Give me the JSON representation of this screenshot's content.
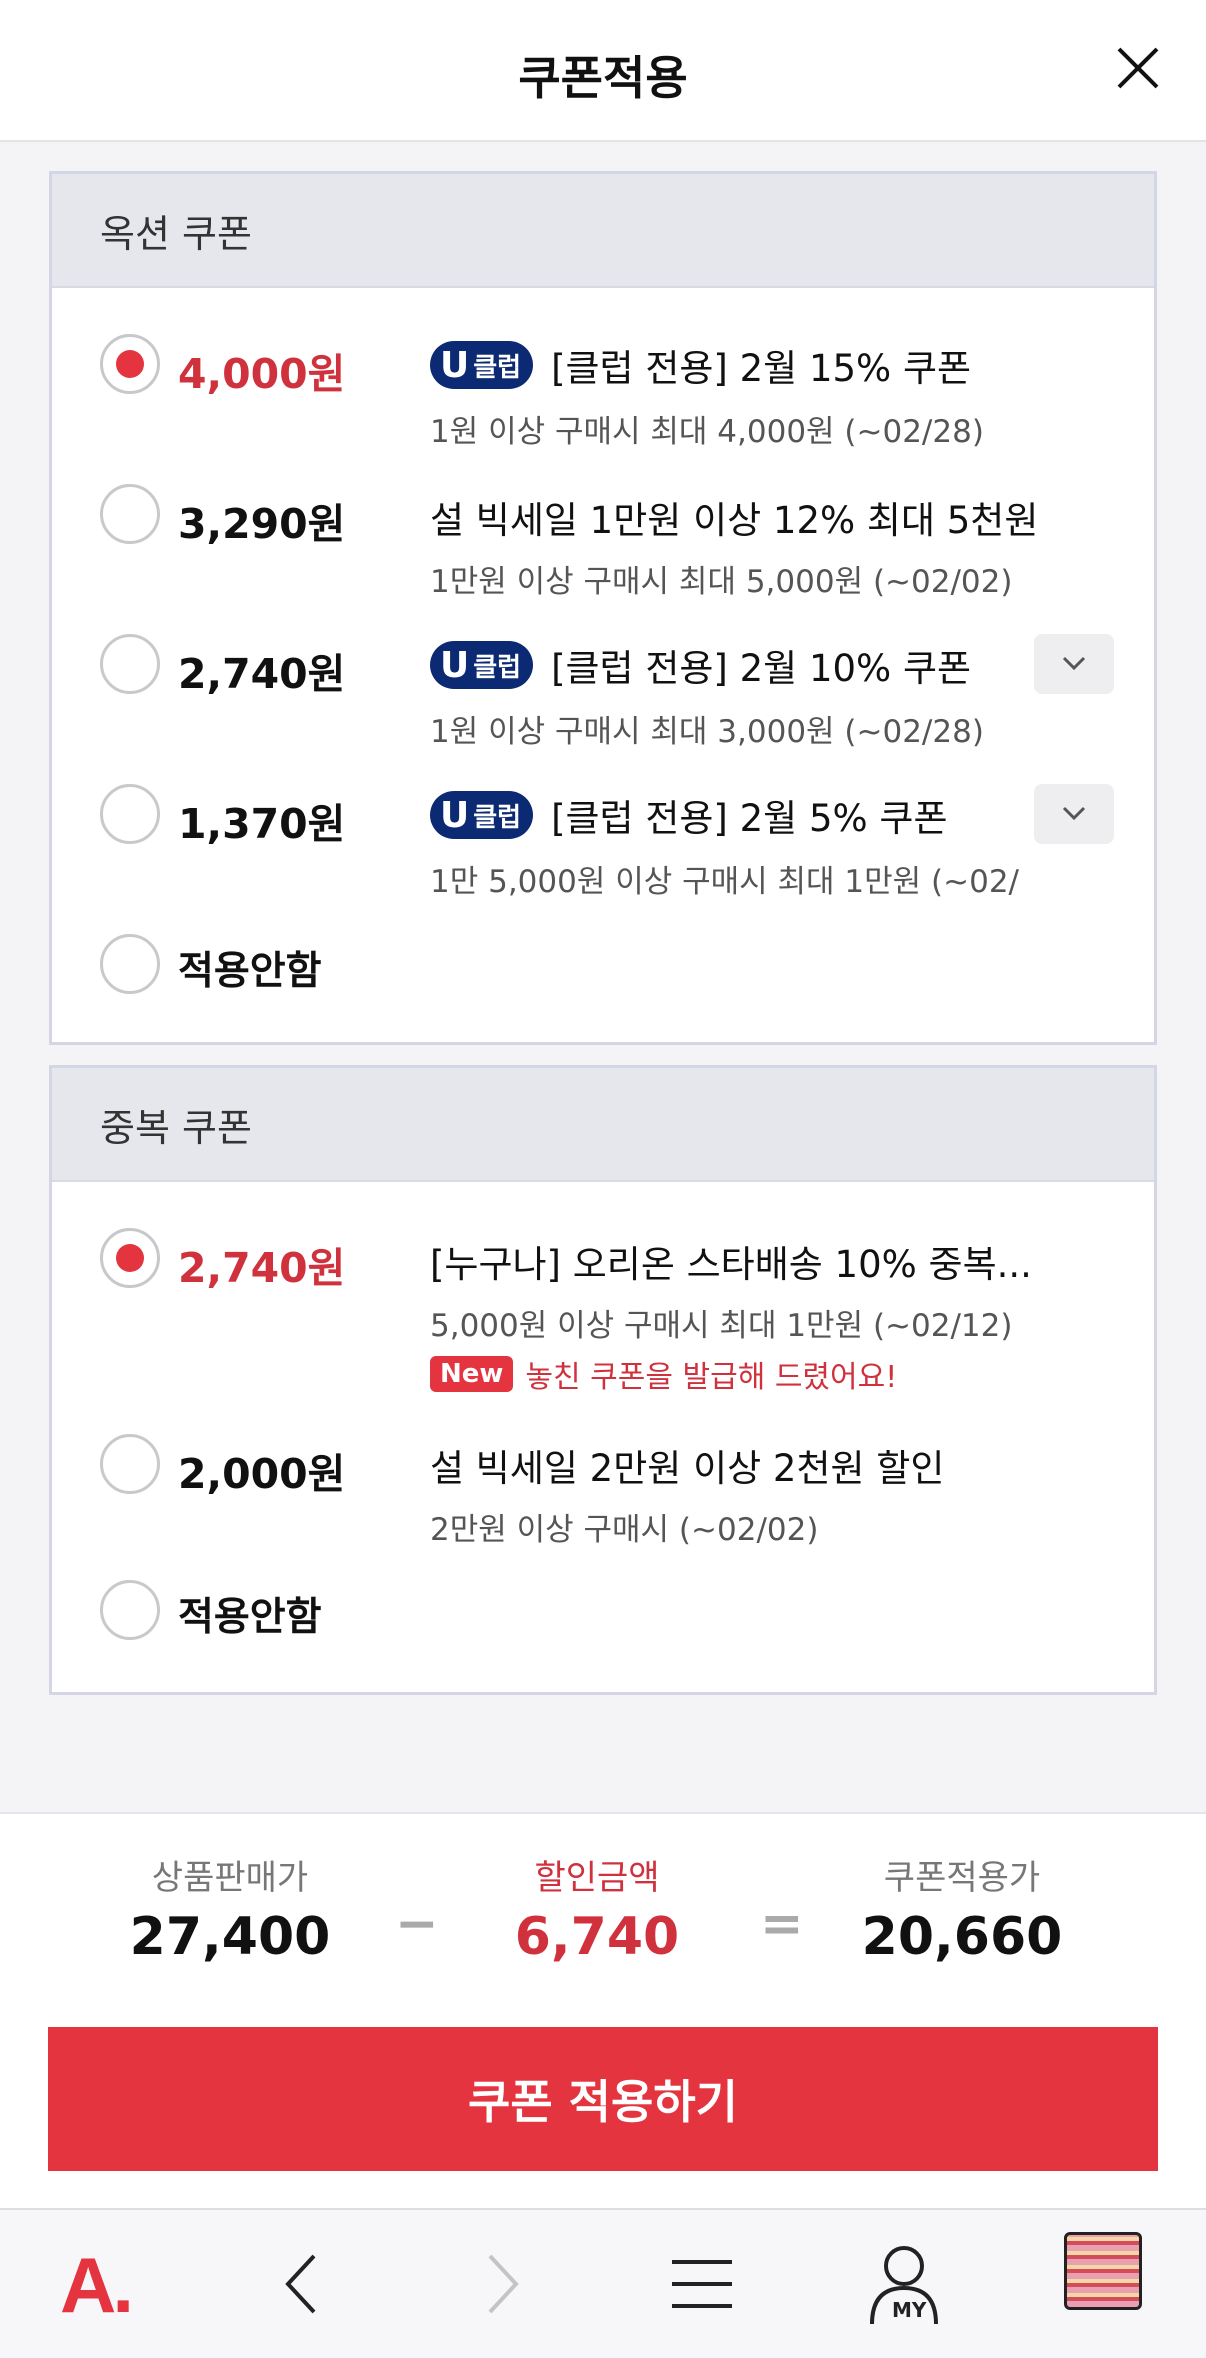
{
  "header": {
    "title": "쿠폰적용"
  },
  "option_section": {
    "title": "옥션 쿠폰",
    "items": [
      {
        "amount": "4,000원",
        "badge": "클럽",
        "title": "[클럽 전용] 2월 15% 쿠폰",
        "sub": "1원 이상 구매시 최대 4,000원 (~02/28)",
        "selected": true
      },
      {
        "amount": "3,290원",
        "title": "설 빅세일 1만원 이상 12% 최대 5천원",
        "sub": "1만원 이상 구매시 최대 5,000원 (~02/02)",
        "selected": false
      },
      {
        "amount": "2,740원",
        "badge": "클럽",
        "title": "[클럽 전용] 2월 10% 쿠폰",
        "sub": "1원 이상 구매시 최대 3,000원 (~02/28)",
        "selected": false
      },
      {
        "amount": "1,370원",
        "badge": "클럽",
        "title": "[클럽 전용] 2월 5% 쿠폰",
        "sub": "1만 5,000원 이상 구매시 최대 1만원 (~02/",
        "selected": false
      }
    ],
    "none_label": "적용안함"
  },
  "dup_section": {
    "title": "중복 쿠폰",
    "items": [
      {
        "amount": "2,740원",
        "title": "[누구나] 오리온 스타배송 10% 중복...",
        "sub": "5,000원 이상 구매시 최대 1만원 (~02/12)",
        "new_badge": "New",
        "new_text": "놓친 쿠폰을 발급해 드렸어요!",
        "selected": true
      },
      {
        "amount": "2,000원",
        "title": "설 빅세일 2만원 이상 2천원 할인",
        "sub": "2만원 이상 구매시 (~02/02)",
        "selected": false
      }
    ],
    "none_label": "적용안함"
  },
  "summary": {
    "price_label": "상품판매가",
    "price": "27,400",
    "minus": "−",
    "discount_label": "할인금액",
    "discount": "6,740",
    "equals": "=",
    "final_label": "쿠폰적용가",
    "final": "20,660"
  },
  "apply_button": "쿠폰 적용하기",
  "nav": {
    "logo": "A.",
    "my": "MY"
  },
  "colors": {
    "accent": "#e4343f",
    "selected_text": "#d0323d",
    "club_badge": "#0b2a73"
  }
}
